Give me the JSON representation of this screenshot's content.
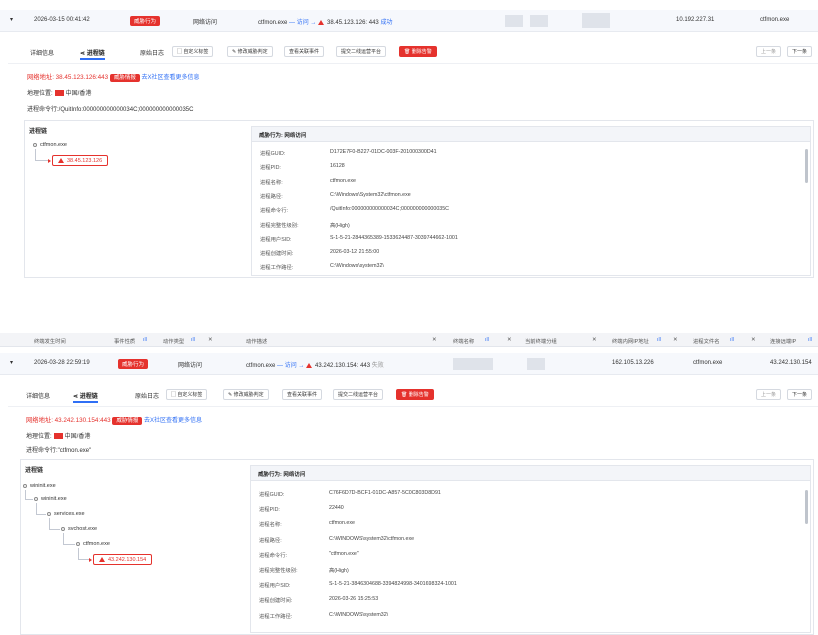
{
  "panel1": {
    "row": {
      "time": "2026-03-15 00:41:42",
      "tag": "威胁行为",
      "type": "网络访问",
      "process": "ctfmon.exe",
      "arrow_label": "— 访问 →",
      "ip": "38.45.123.126",
      "port_status": ": 443",
      "status": "成功",
      "client_ip": "10.192.227.31",
      "filename": "ctfmon.exe"
    },
    "tabs": {
      "detail": "详细信息",
      "chain": "进程链",
      "raw_log": "原始日志",
      "custom_tag": "自定义标签",
      "modify": "修改威胁判定",
      "related": "查看关联事件",
      "submit": "提交二线运营平台",
      "delete": "删除告警",
      "prev": "上一条",
      "next": "下一条"
    },
    "info": {
      "net_label": "网络地址:",
      "net_value": "38.45.123.126:443",
      "intel_tag": "威胁情报",
      "intel_link": "去X社区查看更多信息",
      "loc_label": "地理位置:",
      "loc_value": "中国/香港",
      "cmd_label": "进程命令行:",
      "cmd_value": "/QuitInfo:000000000000034C;000000000000035C"
    },
    "chain_title": "进程链",
    "nodes": [
      "ctfmon.exe"
    ],
    "ip_node": "38.45.123.126",
    "detail_title": "威胁行为: 网络访问",
    "details": [
      {
        "k": "进程GUID:",
        "v": "D172E7F0-B227-01DC-003F-201000300D41"
      },
      {
        "k": "进程PID:",
        "v": "16128"
      },
      {
        "k": "进程名称:",
        "v": "ctfmon.exe"
      },
      {
        "k": "进程路径:",
        "v": "C:\\Windows\\System32\\ctfmon.exe"
      },
      {
        "k": "进程命令行:",
        "v": "/QuitInfo:000000000000034C;000000000000035C"
      },
      {
        "k": "进程完整性级别:",
        "v": "高(High)"
      },
      {
        "k": "进程用户SID:",
        "v": "S-1-5-21-2844365389-1533624487-3039744662-1001"
      },
      {
        "k": "进程创建时间:",
        "v": "2026-03-12 21:55:00"
      },
      {
        "k": "进程工作路径:",
        "v": "C:\\Windows\\system32\\"
      }
    ]
  },
  "panel2": {
    "columns": [
      "终端发生时间",
      "事件性质",
      "动作类型",
      "动作描述",
      "终端名称",
      "当前终端分组",
      "终端内网IP地址",
      "进程文件名",
      "连接远端IP"
    ],
    "row": {
      "time": "2026-03-28 22:59:19",
      "tag": "威胁行为",
      "type": "网络访问",
      "process": "ctfmon.exe",
      "arrow_label": "— 访问 →",
      "ip": "43.242.130.154",
      "port_status": ": 443",
      "status": "失败",
      "client_ip": "162.105.13.226",
      "filename": "ctfmon.exe",
      "remote_ip": "43.242.130.154"
    },
    "tabs": {
      "detail": "详细信息",
      "chain": "进程链",
      "raw_log": "原始日志",
      "custom_tag": "自定义标签",
      "modify": "修改威胁判定",
      "related": "查看关联事件",
      "submit": "提交二线运营平台",
      "delete": "删除告警",
      "prev": "上一条",
      "next": "下一条"
    },
    "info": {
      "net_label": "网络地址:",
      "net_value": "43.242.130.154:443",
      "intel_tag": "威胁情报",
      "intel_link": "去X社区查看更多信息",
      "loc_label": "地理位置:",
      "loc_value": "中国/香港",
      "cmd_label": "进程命令行:",
      "cmd_value": "\"ctfmon.exe\""
    },
    "chain_title": "进程链",
    "nodes": [
      "wininit.exe",
      "wininit.exe",
      "services.exe",
      "svchost.exe",
      "ctfmon.exe"
    ],
    "ip_node": "43.242.130.154",
    "detail_title": "威胁行为: 网络访问",
    "details": [
      {
        "k": "进程GUID:",
        "v": "C76F6D7D-BCF1-01DC-A857-5C0C803D8D91"
      },
      {
        "k": "进程PID:",
        "v": "22440"
      },
      {
        "k": "进程名称:",
        "v": "ctfmon.exe"
      },
      {
        "k": "进程路径:",
        "v": "C:\\WINDOWS\\system32\\ctfmon.exe"
      },
      {
        "k": "进程命令行:",
        "v": "\"ctfmon.exe\""
      },
      {
        "k": "进程完整性级别:",
        "v": "高(High)"
      },
      {
        "k": "进程用户SID:",
        "v": "S-1-5-21-3846304688-3394824998-3401698324-1001"
      },
      {
        "k": "进程创建时间:",
        "v": "2026-03-26 15:25:53"
      },
      {
        "k": "进程工作路径:",
        "v": "C:\\WINDOWS\\system32\\"
      }
    ]
  }
}
